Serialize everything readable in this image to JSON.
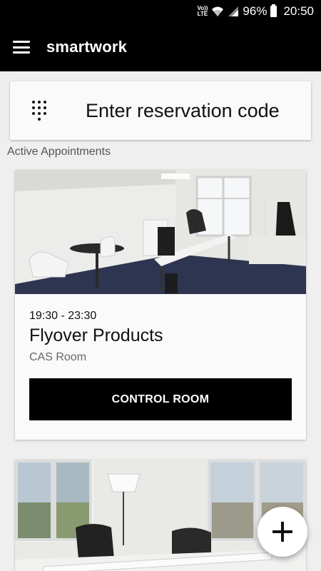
{
  "status_bar": {
    "volte_top": "Vo))",
    "volte_bottom": "LTE",
    "battery_percent": "96%",
    "time": "20:50"
  },
  "app_bar": {
    "title": "smartwork"
  },
  "reservation": {
    "placeholder": "Enter reservation code"
  },
  "section": {
    "label": "Active Appointments"
  },
  "appointments": [
    {
      "time": "19:30 - 23:30",
      "title": "Flyover Products",
      "room": "CAS Room",
      "action_label": "CONTROL ROOM"
    }
  ],
  "colors": {
    "bar": "#000000",
    "background": "#efefef",
    "card": "#fafafa",
    "button": "#000000",
    "button_text": "#ffffff"
  },
  "icons": {
    "menu": "hamburger-menu-icon",
    "keypad": "dialpad-icon",
    "fab": "plus-icon",
    "wifi": "wifi-icon",
    "signal": "signal-icon",
    "battery": "battery-icon"
  }
}
